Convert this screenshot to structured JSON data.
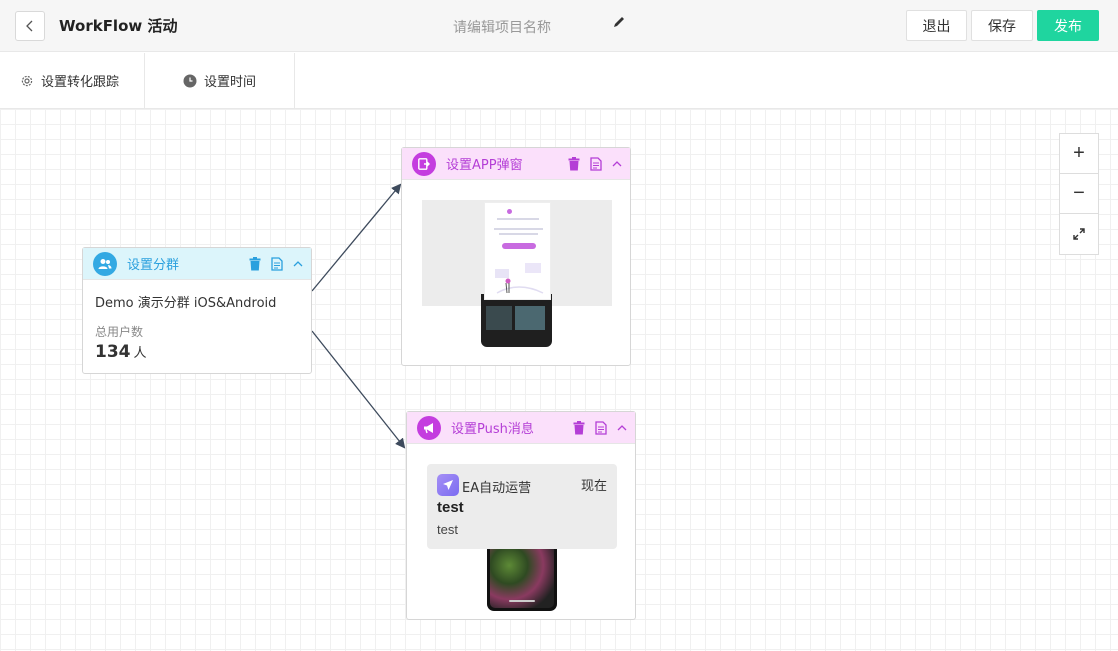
{
  "header": {
    "title": "WorkFlow 活动",
    "project_placeholder": "请编辑项目名称",
    "exit_label": "退出",
    "save_label": "保存",
    "publish_label": "发布",
    "publish_color": "#1fd59f"
  },
  "toolbar": {
    "conversion_label": "设置转化跟踪",
    "time_label": "设置时间"
  },
  "zoom": {
    "zoom_in": "+",
    "zoom_out": "−"
  },
  "nodes": {
    "segment": {
      "title": "设置分群",
      "name": "Demo 演示分群 iOS&Android",
      "users_label": "总用户数",
      "users_count": "134",
      "users_unit": "人",
      "accent": "#33a9e3"
    },
    "popup": {
      "title": "设置APP弹窗",
      "accent": "#c43ddf"
    },
    "push": {
      "title": "设置Push消息",
      "app_name": "EA自动运营",
      "time": "现在",
      "message_title": "test",
      "message_body": "test",
      "accent": "#c43ddf"
    }
  }
}
